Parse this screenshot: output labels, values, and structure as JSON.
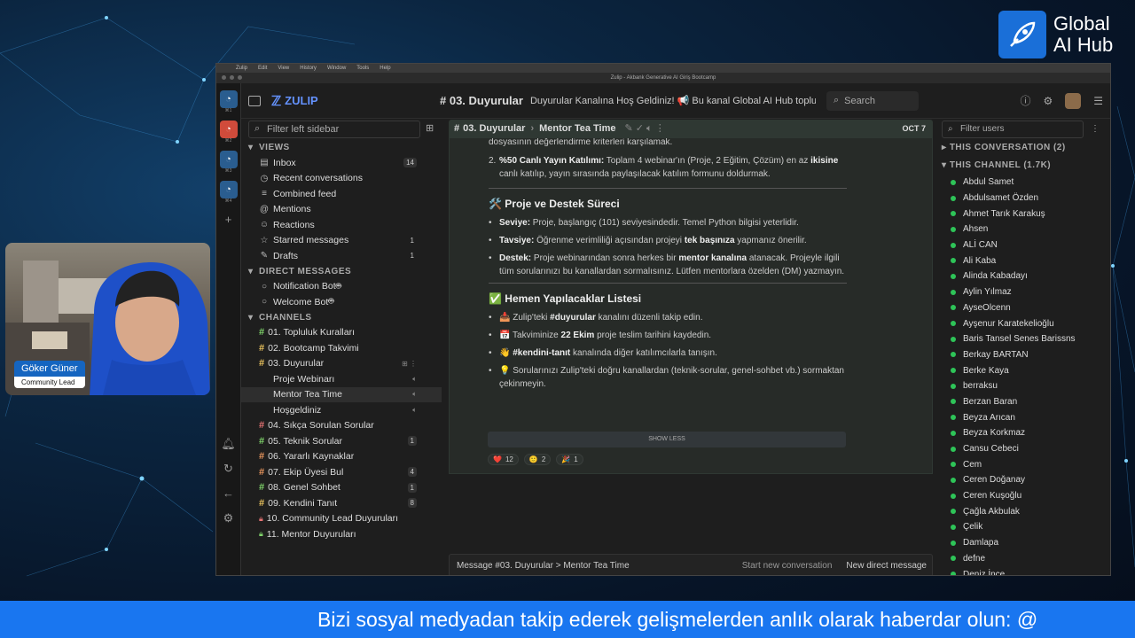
{
  "brand": {
    "line1": "Global",
    "line2": "AI Hub"
  },
  "camera": {
    "name": "Göker Güner",
    "role": "Community Lead"
  },
  "banner": "Bizi sosyal medyadan takip ederek gelişmelerden anlık olarak haberdar olun: @",
  "window": {
    "menu": [
      "Zulip",
      "Edit",
      "View",
      "History",
      "Window",
      "Tools",
      "Help"
    ],
    "title": "Zulip - Akbank Generative AI Giriş Bootcamp"
  },
  "rail": {
    "org_labels": [
      "⌘1",
      "⌘2",
      "⌘3",
      "⌘4"
    ]
  },
  "header": {
    "logo": "ZULIP",
    "channel": "03. Duyurular",
    "description": "Duyurular Kanalına Hoş Geldiniz! 📢 Bu kanal Global AI Hub topluluğu",
    "search": "Search"
  },
  "left": {
    "filter": "Filter left sidebar",
    "views_title": "VIEWS",
    "views": [
      {
        "icon": "inbox-icon",
        "glyph": "▤",
        "label": "Inbox",
        "count": "14"
      },
      {
        "icon": "clock-icon",
        "glyph": "◷",
        "label": "Recent conversations",
        "count": ""
      },
      {
        "icon": "feed-icon",
        "glyph": "≡",
        "label": "Combined feed",
        "count": ""
      },
      {
        "icon": "at-icon",
        "glyph": "@",
        "label": "Mentions",
        "count": ""
      },
      {
        "icon": "smile-icon",
        "glyph": "☺",
        "label": "Reactions",
        "count": ""
      },
      {
        "icon": "star-icon",
        "glyph": "☆",
        "label": "Starred messages",
        "count": "1"
      },
      {
        "icon": "pencil-icon",
        "glyph": "✎",
        "label": "Drafts",
        "count": "1"
      }
    ],
    "dm_title": "DIRECT MESSAGES",
    "dms": [
      "Notification Bot",
      "Welcome Bot"
    ],
    "channels_title": "CHANNELS",
    "channels": [
      {
        "label": "01. Topluluk Kuralları",
        "color": "#7fd36a",
        "count": ""
      },
      {
        "label": "02. Bootcamp Takvimi",
        "color": "#e8c15d",
        "count": ""
      },
      {
        "label": "03. Duyurular",
        "color": "#e8c15d",
        "count": ""
      },
      {
        "label": "04. Sıkça Sorulan Sorular",
        "color": "#e57373",
        "count": ""
      },
      {
        "label": "05. Teknik Sorular",
        "color": "#7fd36a",
        "count": "1"
      },
      {
        "label": "06. Yararlı Kaynaklar",
        "color": "#e8955d",
        "count": ""
      },
      {
        "label": "07. Ekip Üyesi Bul",
        "color": "#e8955d",
        "count": "4"
      },
      {
        "label": "08. Genel Sohbet",
        "color": "#7fd36a",
        "count": "1"
      },
      {
        "label": "09. Kendini Tanıt",
        "color": "#e8c15d",
        "count": "8"
      },
      {
        "label": "10. Community Lead Duyuruları",
        "color": "#e57373",
        "count": ""
      },
      {
        "label": "11. Mentor Duyuruları",
        "color": "#7fd36a",
        "count": ""
      }
    ],
    "topics": [
      "Proje Webinarı",
      "Mentor Tea Time",
      "Hoşgeldiniz"
    ]
  },
  "recipient": {
    "channel": "03. Duyurular",
    "topic": "Mentor Tea Time",
    "date": "OCT 7"
  },
  "message": {
    "line0": "dosyasının değerlendirme kriterleri karşılamak.",
    "item2_num": "2.",
    "item2_bold": "%50 Canlı Yayın Katılımı:",
    "item2_text": " Toplam 4 webinar'ın (Proje, 2 Eğitim, Çözüm) en az ",
    "item2_bold2": "ikisine",
    "item2_text2": " canlı katılıp, yayın sırasında paylaşılacak katılım formunu doldurmak.",
    "h1": "🛠️ Proje ve Destek Süreci",
    "s1_bold": "Seviye:",
    "s1_text": " Proje, başlangıç (101) seviyesindedir. Temel Python bilgisi yeterlidir.",
    "s2_bold": "Tavsiye:",
    "s2_text": " Öğrenme verimliliği açısından projeyi ",
    "s2_bold2": "tek başınıza",
    "s2_text2": " yapmanız önerilir.",
    "s3_bold": "Destek:",
    "s3_text": " Proje webinarından sonra herkes bir ",
    "s3_bold2": "mentor kanalına",
    "s3_text2": " atanacak. Projeyle ilgili tüm sorularınızı bu kanallardan sormalısınız. Lütfen mentorlara özelden (DM) yazmayın.",
    "h2": "✅ Hemen Yapılacaklar Listesi",
    "t1_pre": "📥 Zulip'teki ",
    "t1_bold": "#duyurular",
    "t1_text": " kanalını düzenli takip edin.",
    "t2_pre": "📅 Takviminize ",
    "t2_bold": "22 Ekim",
    "t2_text": " proje teslim tarihini kaydedin.",
    "t3_pre": "👋 ",
    "t3_bold": "#kendini-tanıt",
    "t3_text": " kanalında diğer katılımcılarla tanışın.",
    "t4": "💡 Sorularınızı Zulip'teki doğru kanallardan (teknik-sorular, genel-sohbet vb.) sormaktan çekinmeyin.",
    "show_less": "SHOW LESS",
    "reactions": [
      {
        "emoji": "❤️",
        "count": "12"
      },
      {
        "emoji": "🙂",
        "count": "2"
      },
      {
        "emoji": "🎉",
        "count": "1"
      }
    ]
  },
  "compose": {
    "placeholder": "Message #03. Duyurular > Mentor Tea Time",
    "new_conv": "Start new conversation",
    "new_dm": "New direct message"
  },
  "right": {
    "filter": "Filter users",
    "this_conv": "THIS CONVERSATION (2)",
    "this_channel": "THIS CHANNEL (1.7K)",
    "users": [
      "Abdul Samet",
      "Abdulsamet Özden",
      "Ahmet Tarık Karakuş",
      "Ahsen",
      "ALİ CAN",
      "Ali Kaba",
      "Alinda Kabadayı",
      "Aylin Yılmaz",
      "AyseOlcenn",
      "Ayşenur Karatekelioğlu",
      "Baris Tansel Senes Barissns",
      "Berkay BARTAN",
      "Berke Kaya",
      "berraksu",
      "Berzan Baran",
      "Beyza Arıcan",
      "Beyza Korkmaz",
      "Cansu Cebeci",
      "Cem",
      "Ceren Doğanay",
      "Ceren Kuşoğlu",
      "Çağla Akbulak",
      "Çelik",
      "Damlapa",
      "defne",
      "Deniz İnce"
    ]
  },
  "colors": {
    "accent": "#6492fe",
    "banner": "#1976f0",
    "online": "#2ec458"
  }
}
